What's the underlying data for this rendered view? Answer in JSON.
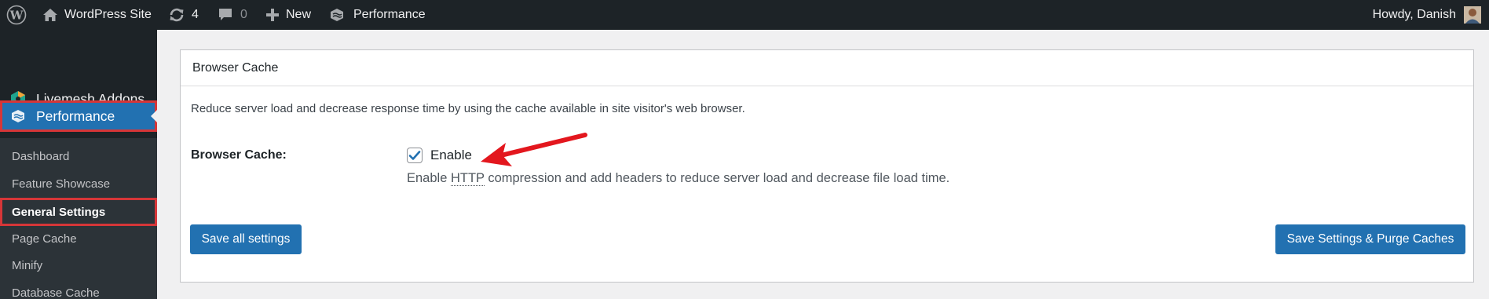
{
  "admin_bar": {
    "site_name": "WordPress Site",
    "updates_count": "4",
    "comments_count": "0",
    "new_label": "New",
    "plugin_label": "Performance",
    "greeting": "Howdy, Danish"
  },
  "sidebar": {
    "livemesh_label": "Livemesh Addons",
    "performance_label": "Performance",
    "submenu": [
      {
        "label": "Dashboard"
      },
      {
        "label": "Feature Showcase"
      },
      {
        "label": "General Settings"
      },
      {
        "label": "Page Cache"
      },
      {
        "label": "Minify"
      },
      {
        "label": "Database Cache"
      }
    ]
  },
  "panel": {
    "title": "Browser Cache",
    "intro": "Reduce server load and decrease response time by using the cache available in site visitor's web browser.",
    "field_label": "Browser Cache:",
    "checkbox_label": "Enable",
    "checkbox_checked": true,
    "desc_before": "Enable ",
    "desc_abbr": "HTTP",
    "desc_after": " compression and add headers to reduce server load and decrease file load time.",
    "save_all_label": "Save all settings",
    "save_purge_label": "Save Settings & Purge Caches"
  },
  "colors": {
    "admin_bar_bg": "#1d2327",
    "accent": "#2271b1",
    "highlight_border": "#d63638",
    "annotation_arrow": "#e3171e"
  }
}
